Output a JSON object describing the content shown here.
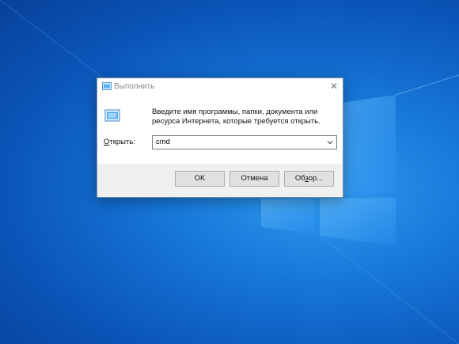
{
  "dialog": {
    "title": "Выполнить",
    "description": "Введите имя программы, папки, документа или ресурса Интернета, которые требуется открыть.",
    "open_label_pre": "",
    "open_label_accel": "О",
    "open_label_post": "ткрыть:",
    "combo_value": "cmd",
    "ok_label": "OK",
    "cancel_label": "Отмена",
    "browse_label_pre": "Об",
    "browse_label_accel": "з",
    "browse_label_post": "ор...",
    "close_glyph": "✕"
  },
  "colors": {
    "desktop": "#1677d8",
    "dialog_footer": "#f0f0f0"
  }
}
